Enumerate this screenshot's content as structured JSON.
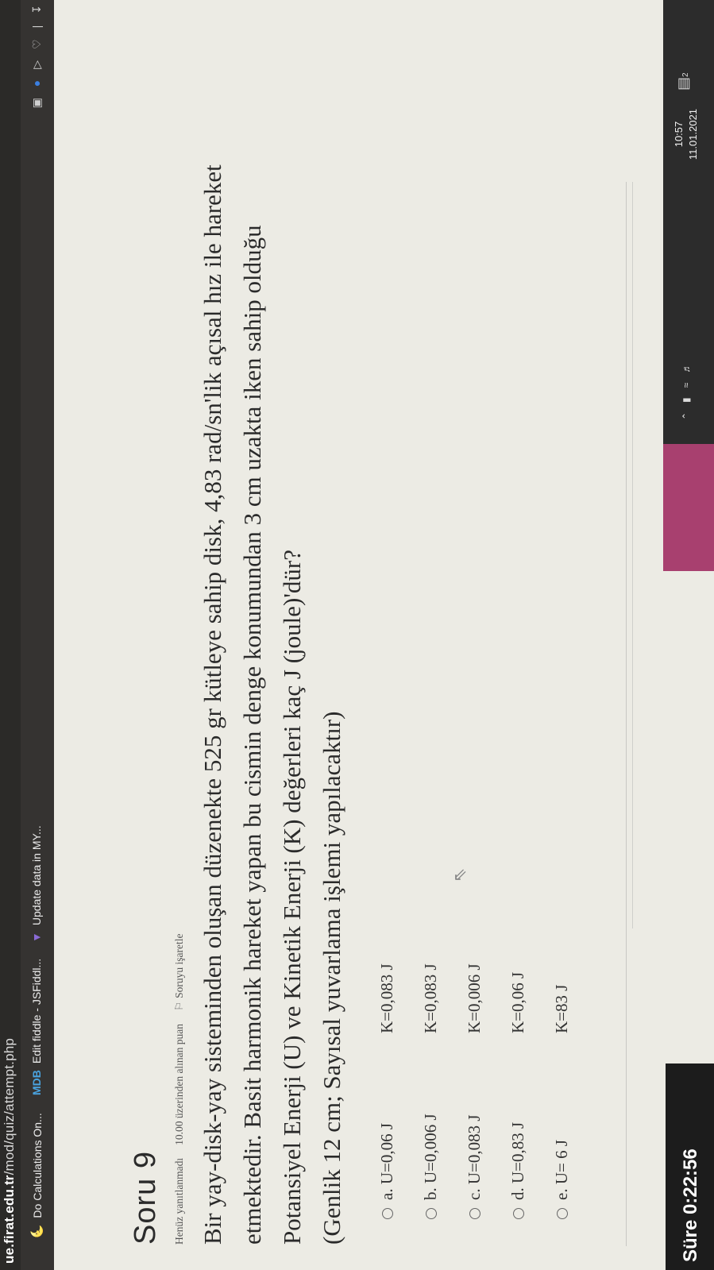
{
  "browser": {
    "url_host": "ue.firat.edu.tr",
    "url_path": "/mod/quiz/attempt.php",
    "bookmarks": [
      {
        "icon": "calculator-icon",
        "label": "Do Calculations On..."
      },
      {
        "icon": "mdb-icon",
        "label": "Edit fiddle - JSFiddl..."
      },
      {
        "icon": "power-bi-icon",
        "label": "Update data in MY..."
      }
    ]
  },
  "question": {
    "title": "Soru 9",
    "status": "Henüz yanıtlanmadı",
    "points": "10.00 üzerinden alınan puan",
    "flag_label": "Soruyu işaretle",
    "text": "Bir yay-disk-yay sisteminden oluşan düzenekte 525 gr kütleye sahip disk, 4,83 rad/sn'lik açısal hız ile hareket etmektedir. Basit harmonik hareket yapan bu cismin denge konumundan 3 cm uzakta iken sahip olduğu Potansiyel Enerji (U) ve Kinetik Enerji (K) değerleri kaç J (joule)'dür?",
    "note": "(Genlik 12 cm; Sayısal yuvarlama işlemi yapılacaktır)",
    "options": [
      {
        "prefix": "a.",
        "u": "U=0,06 J",
        "k": "K=0,083 J"
      },
      {
        "prefix": "b.",
        "u": "U=0,006 J",
        "k": "K=0,083 J"
      },
      {
        "prefix": "c.",
        "u": "U=0,083 J",
        "k": "K=0,006 J"
      },
      {
        "prefix": "d.",
        "u": "U=0,83 J",
        "k": "K=0,06 J"
      },
      {
        "prefix": "e.",
        "u": "U= 6 J",
        "k": "K=83 J"
      }
    ]
  },
  "timer": {
    "label": "Süre 0:22:56"
  },
  "system": {
    "time": "10:57",
    "date": "11.01.2021",
    "notifications": "2"
  }
}
